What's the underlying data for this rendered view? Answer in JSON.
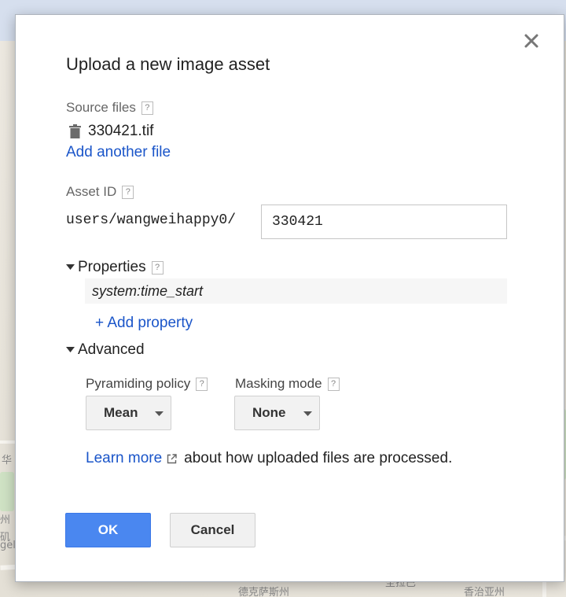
{
  "dialog": {
    "title": "Upload a new image asset",
    "close_symbol": "×"
  },
  "source_files": {
    "label": "Source files",
    "help": "?",
    "files": [
      "330421.tif"
    ],
    "add_another_label": "Add another file"
  },
  "asset_id": {
    "label": "Asset ID",
    "help": "?",
    "prefix": "users/wangweihappy0/",
    "value": "330421"
  },
  "properties": {
    "label": "Properties",
    "help": "?",
    "items": [
      {
        "name": "system:time_start"
      }
    ],
    "add_property_label": "+ Add property"
  },
  "advanced": {
    "label": "Advanced",
    "pyramiding_policy": {
      "label": "Pyramiding policy",
      "help": "?",
      "value": "Mean"
    },
    "masking_mode": {
      "label": "Masking mode",
      "help": "?",
      "value": "None"
    }
  },
  "learn_more": {
    "link_label": "Learn more",
    "rest_text": "about how uploaded files are processed."
  },
  "buttons": {
    "ok_label": "OK",
    "cancel_label": "Cancel"
  },
  "background_map": {
    "labels": [
      "华",
      "州",
      "矶",
      "gele",
      "德克萨斯州",
      "圣拉巴",
      "香治亚州",
      "达"
    ]
  },
  "colors": {
    "link": "#1a55c9",
    "primary_button": "#4a87f0",
    "dialog_background": "#ffffff"
  },
  "icons": [
    "close-icon",
    "trash-icon",
    "caret-down-icon",
    "dropdown-arrow-icon",
    "external-link-icon",
    "help-icon"
  ]
}
